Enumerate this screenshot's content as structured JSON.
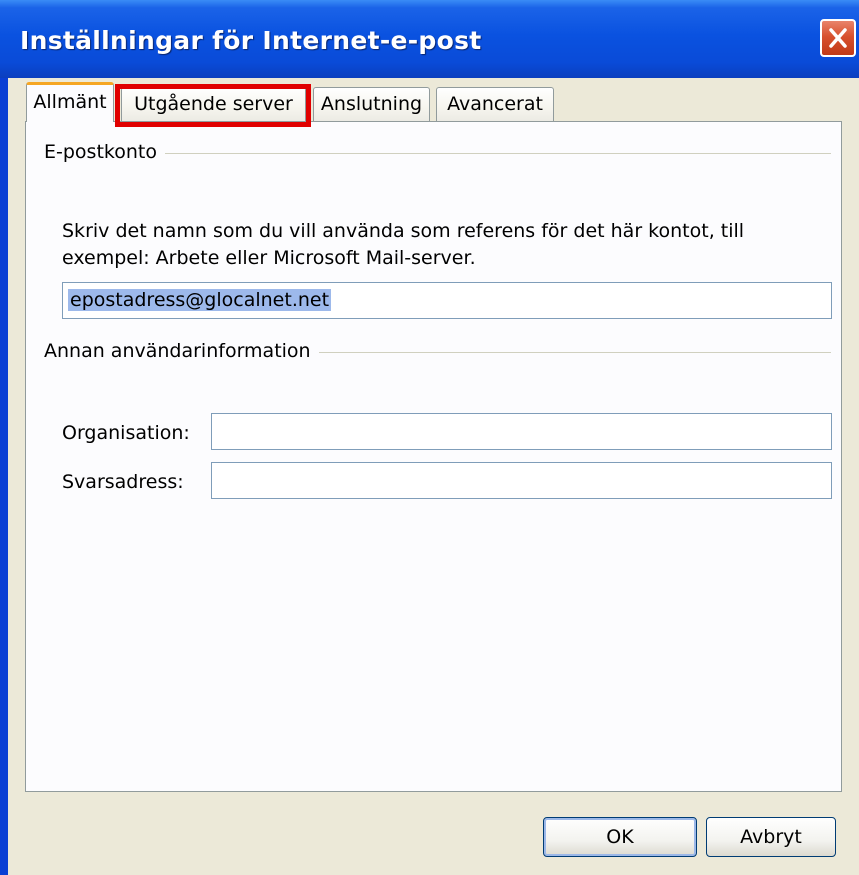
{
  "window": {
    "title": "Inställningar för Internet-e-post",
    "close_symbol": "×"
  },
  "tabs": [
    {
      "label": "Allmänt",
      "active": true
    },
    {
      "label": "Utgående server",
      "active": false,
      "highlighted": true
    },
    {
      "label": "Anslutning",
      "active": false
    },
    {
      "label": "Avancerat",
      "active": false
    }
  ],
  "email_account": {
    "group_title": "E-postkonto",
    "description": "Skriv det namn som du vill använda som referens för det här kontot, till exempel: Arbete eller Microsoft Mail-server.",
    "account_name_value": "epostadress@glocalnet.net"
  },
  "other_info": {
    "group_title": "Annan användarinformation",
    "organization_label": "Organisation:",
    "organization_value": "",
    "reply_label": "Svarsadress:",
    "reply_value": ""
  },
  "buttons": {
    "ok": "OK",
    "cancel": "Avbryt"
  },
  "colors": {
    "titlebar": "#0a52e0",
    "highlight_box": "#e00000",
    "dialog_bg": "#ece9d8"
  }
}
